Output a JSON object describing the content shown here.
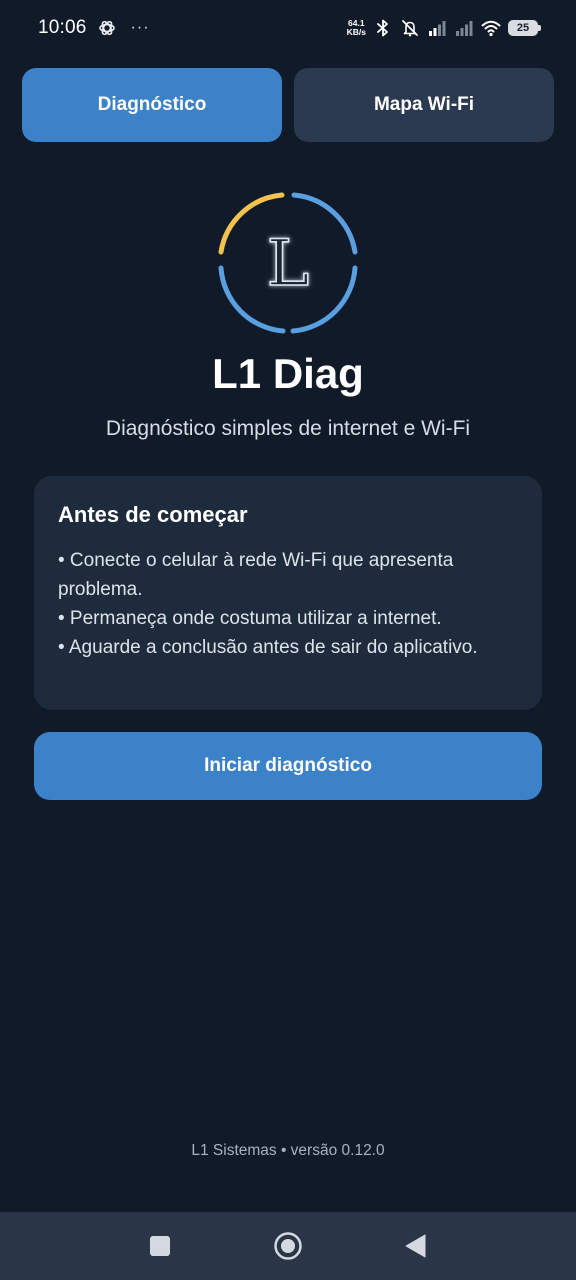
{
  "status_bar": {
    "time": "10:06",
    "more_indicator": "···",
    "net_speed_value": "64.1",
    "net_speed_unit": "KB/s",
    "battery": "25",
    "icons": [
      "openai-icon",
      "bluetooth-icon",
      "mute-icon",
      "signal-icon",
      "signal-icon",
      "wifi-icon",
      "battery-icon"
    ]
  },
  "tabs": [
    {
      "label": "Diagnóstico",
      "active": true
    },
    {
      "label": "Mapa Wi-Fi",
      "active": false
    }
  ],
  "logo": {
    "letter": "L",
    "ring_colors": [
      "#f2c14e",
      "#5aa0e0"
    ]
  },
  "app": {
    "title": "L1 Diag",
    "subtitle": "Diagnóstico simples de internet e Wi-Fi"
  },
  "info_card": {
    "title": "Antes de começar",
    "items": [
      "• Conecte o celular à rede Wi-Fi que apresenta problema.",
      "• Permaneça onde costuma utilizar a internet.",
      "• Aguarde a conclusão antes de sair do aplicativo."
    ]
  },
  "start_button": {
    "label": "Iniciar diagnóstico"
  },
  "footer": {
    "text": "L1 Sistemas • versão 0.12.0"
  },
  "nav_bar": {
    "buttons": [
      "recents-square-icon",
      "home-circle-icon",
      "back-triangle-icon"
    ]
  },
  "colors": {
    "background": "#111a28",
    "accent": "#3b82c8",
    "card": "#1e2b3d",
    "tab_inactive": "#2b3a50",
    "nav_bar": "#2a3548"
  }
}
